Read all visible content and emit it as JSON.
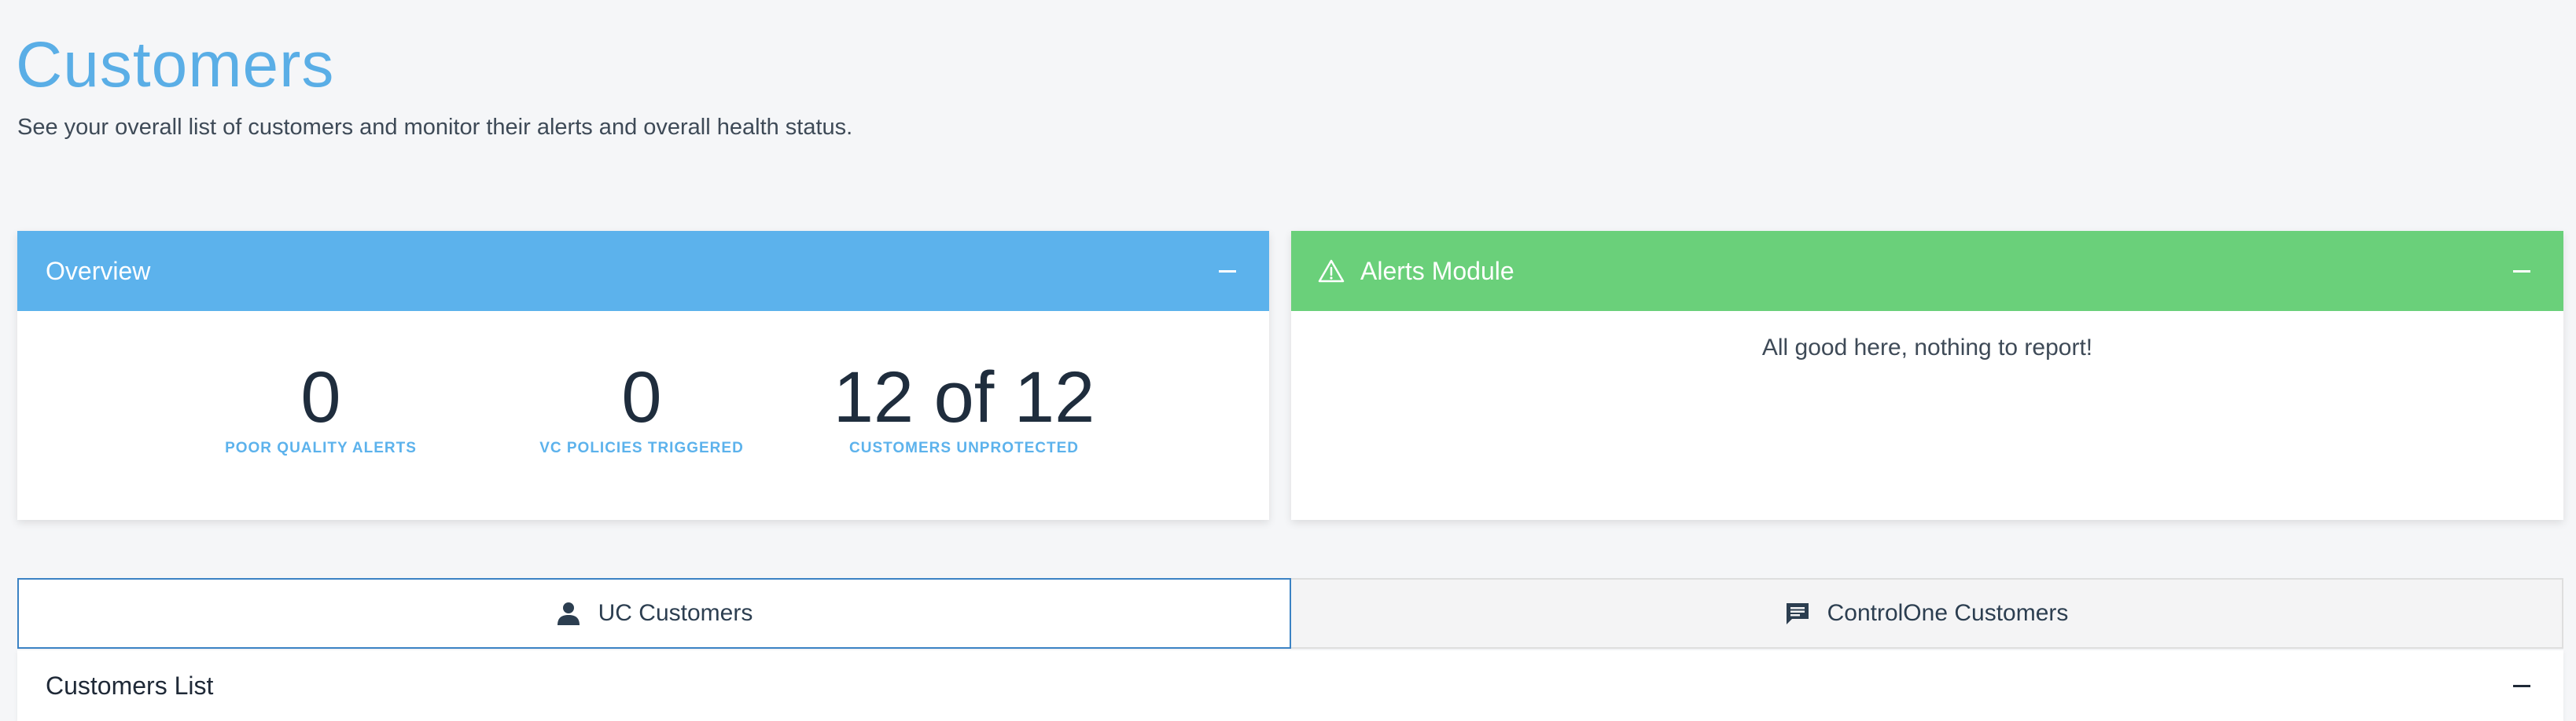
{
  "header": {
    "title": "Customers",
    "subtitle": "See your overall list of customers and monitor their alerts and overall health status."
  },
  "overview": {
    "title": "Overview",
    "stats": [
      {
        "value": "0",
        "label": "POOR QUALITY ALERTS"
      },
      {
        "value": "0",
        "label": "VC POLICIES TRIGGERED"
      },
      {
        "value": "12 of 12",
        "label": "CUSTOMERS UNPROTECTED"
      }
    ]
  },
  "alerts": {
    "title": "Alerts Module",
    "message": "All good here, nothing to report!"
  },
  "tabs": [
    {
      "label": "UC Customers",
      "icon": "user-icon",
      "active": true
    },
    {
      "label": "ControlOne Customers",
      "icon": "chat-icon",
      "active": false
    }
  ],
  "customers_list": {
    "title": "Customers List"
  },
  "colors": {
    "title_blue": "#5aaee6",
    "overview_header": "#5cb2ec",
    "alerts_header": "#6ad07a",
    "active_tab_border": "#3b82c4"
  }
}
